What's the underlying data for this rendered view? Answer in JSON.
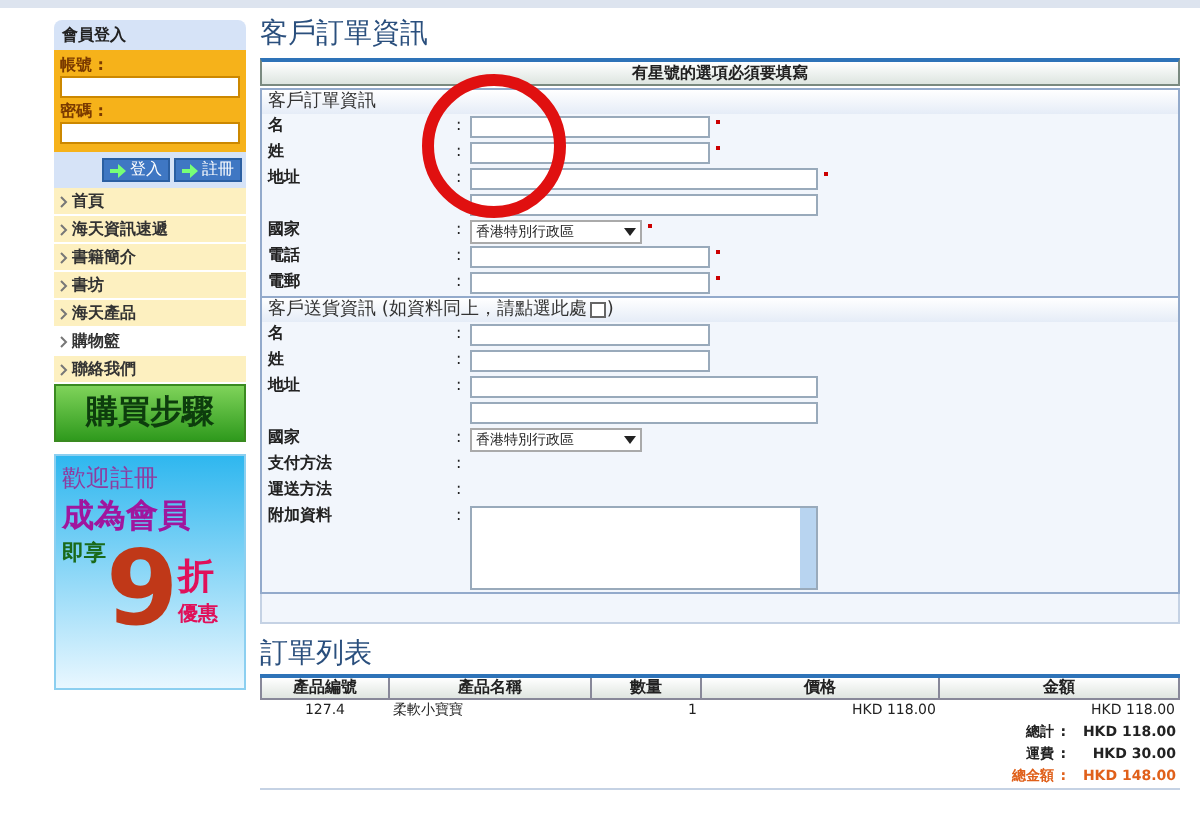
{
  "login": {
    "title": "會員登入",
    "username_label": "帳號 :",
    "password_label": "密碼 :",
    "buttons": [
      "登入",
      "註冊"
    ]
  },
  "nav": [
    {
      "label": "首頁",
      "selected": false
    },
    {
      "label": "海天資訊速遞",
      "selected": false
    },
    {
      "label": "書籍簡介",
      "selected": false
    },
    {
      "label": "書坊",
      "selected": false
    },
    {
      "label": "海天產品",
      "selected": false
    },
    {
      "label": "購物籃",
      "selected": true
    },
    {
      "label": "聯絡我們",
      "selected": false
    }
  ],
  "steps_banner": "購買步驟",
  "promo": {
    "line1": "歡迎註冊",
    "line2": "成為會員",
    "line3": "即享",
    "digit": "9",
    "unit": "折",
    "line4": "優惠"
  },
  "page_title": "客戶訂單資訊",
  "notice": "有星號的選項必須要填寫",
  "billing": {
    "title": "客戶訂單資訊",
    "fields": [
      {
        "label": "名",
        "sep": ":",
        "kind": "text",
        "required": true
      },
      {
        "label": "姓",
        "sep": ":",
        "kind": "text",
        "required": true
      },
      {
        "label": "地址",
        "sep": ":",
        "kind": "address",
        "required": true
      },
      {
        "label": "國家",
        "sep": ":",
        "kind": "select",
        "value": "香港特別行政區",
        "required": true
      },
      {
        "label": "電話",
        "sep": ":",
        "kind": "text",
        "required": true
      },
      {
        "label": "電郵",
        "sep": ":",
        "kind": "text",
        "required": true
      }
    ]
  },
  "shipping": {
    "title": "客戶送貨資訊 (如資料同上，請點選此處",
    "title_end": ")",
    "same_checked": false,
    "fields": [
      {
        "label": "名",
        "sep": ":",
        "kind": "text",
        "required": false
      },
      {
        "label": "姓",
        "sep": ":",
        "kind": "text",
        "required": false
      },
      {
        "label": "地址",
        "sep": ":",
        "kind": "address",
        "required": false
      },
      {
        "label": "國家",
        "sep": ":",
        "kind": "select",
        "value": "香港特別行政區",
        "required": false
      },
      {
        "label": "支付方法",
        "sep": ":",
        "kind": "none",
        "required": false
      },
      {
        "label": "運送方法",
        "sep": ":",
        "kind": "none",
        "required": false
      },
      {
        "label": "附加資料",
        "sep": ":",
        "kind": "textarea",
        "required": false
      }
    ]
  },
  "orders": {
    "title": "訂單列表",
    "columns": [
      "產品編號",
      "產品名稱",
      "數量",
      "價格",
      "金額"
    ],
    "rows": [
      [
        "127.4",
        "柔軟小寶寶",
        "1",
        "HKD 118.00",
        "HKD 118.00"
      ]
    ],
    "totals": [
      {
        "label": "總計",
        "sep": ":",
        "value": "HKD 118.00",
        "highlight": false
      },
      {
        "label": "運費",
        "sep": ":",
        "value": "HKD 30.00",
        "highlight": false
      },
      {
        "label": "總金額",
        "sep": ":",
        "value": "HKD 148.00",
        "highlight": true
      }
    ]
  }
}
